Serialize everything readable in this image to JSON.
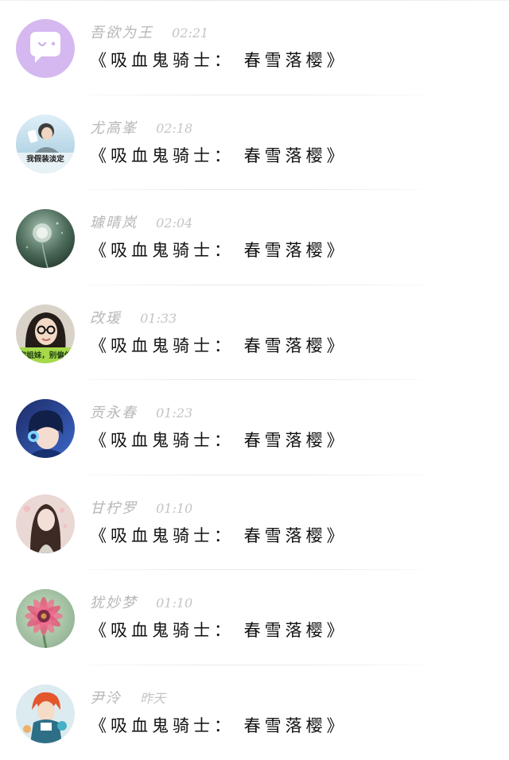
{
  "conversation_list": {
    "items": [
      {
        "name": "吾欲为王",
        "time": "02:21",
        "message": "《吸血鬼骑士： 春雪落樱》",
        "avatar_icon": "chat-bubble-icon"
      },
      {
        "name": "尤高峯",
        "time": "02:18",
        "message": "《吸血鬼骑士： 春雪落樱》",
        "avatar_icon": "profile-photo",
        "avatar_text": "我假装淡定"
      },
      {
        "name": "璩晴岚",
        "time": "02:04",
        "message": "《吸血鬼骑士： 春雪落樱》",
        "avatar_icon": "dandelion-photo"
      },
      {
        "name": "改瑗",
        "time": "01:33",
        "message": "《吸血鬼骑士： 春雪落樱》",
        "avatar_icon": "portrait-photo",
        "avatar_text": "完姐妹，别偏偏"
      },
      {
        "name": "贡永春",
        "time": "01:23",
        "message": "《吸血鬼骑士： 春雪落樱》",
        "avatar_icon": "anime-headphones-avatar"
      },
      {
        "name": "甘柠罗",
        "time": "01:10",
        "message": "《吸血鬼骑士： 春雪落樱》",
        "avatar_icon": "illustrated-portrait"
      },
      {
        "name": "犹妙梦",
        "time": "01:10",
        "message": "《吸血鬼骑士： 春雪落樱》",
        "avatar_icon": "flower-photo"
      },
      {
        "name": "尹泠",
        "time": "昨天",
        "message": "《吸血鬼骑士： 春雪落樱》",
        "avatar_icon": "anime-character-avatar"
      }
    ]
  }
}
